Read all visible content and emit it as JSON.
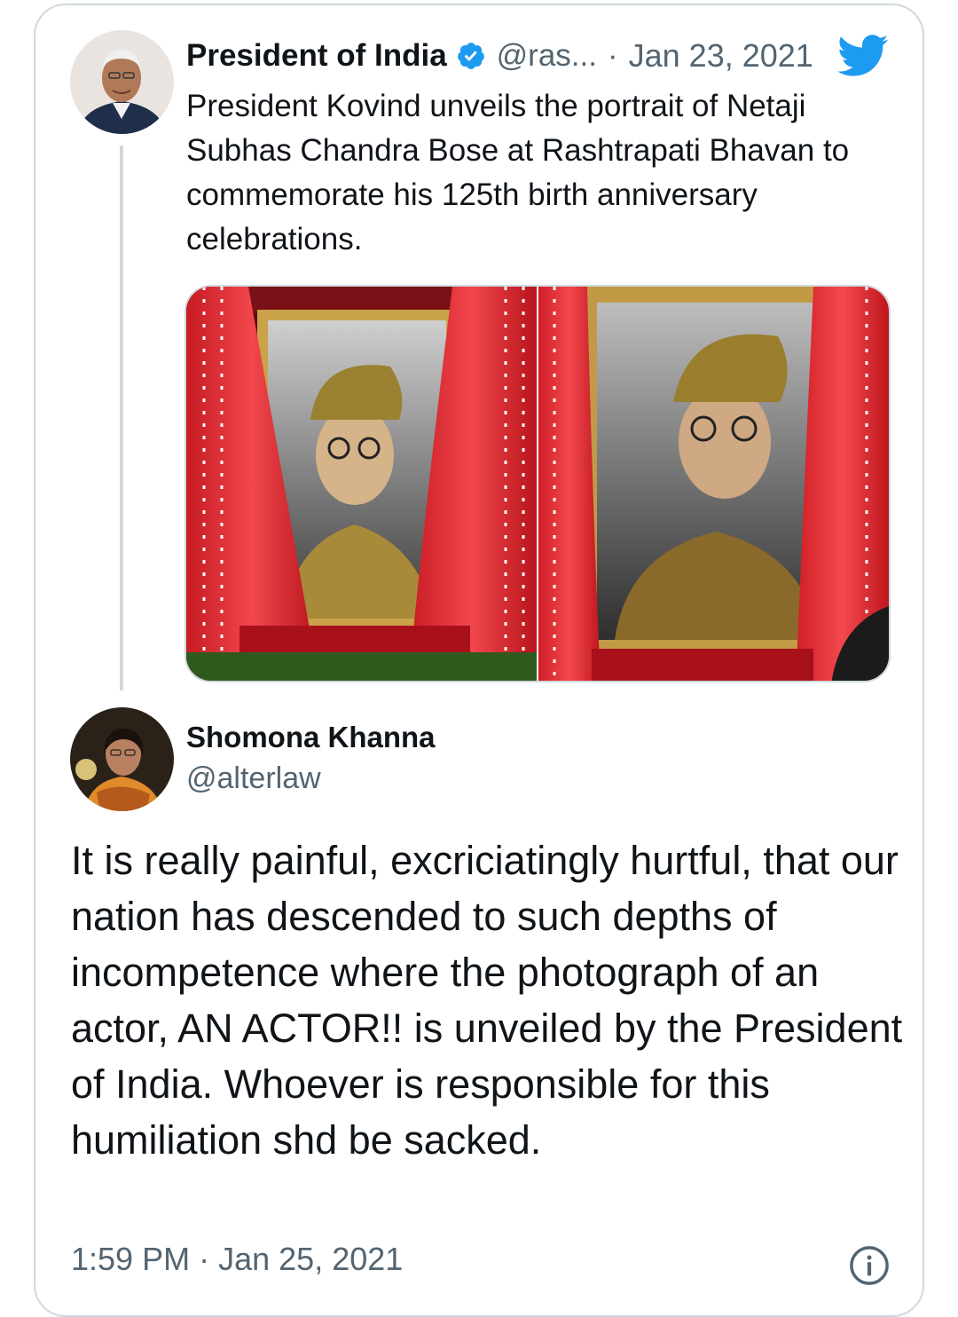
{
  "quoted_tweet": {
    "author_name": "President of India",
    "handle": "@ras...",
    "separator": "·",
    "date": "Jan 23, 2021",
    "text": "President Kovind unveils the portrait of Netaji Subhas Chandra Bose at Rashtrapati Bhavan to commemorate his 125th birth anniversary celebrations.",
    "photo_count": 2,
    "verified": true
  },
  "tweet": {
    "author_name": "Shomona Khanna",
    "handle": "@alterlaw",
    "text": "It is really painful, excriciatingly hurtful, that our nation has descended to such depths of incompetence where the photograph of an actor, AN ACTOR!! is unveiled by the President of India. Whoever is responsible for this humiliation shd be sacked.",
    "time": "1:59 PM",
    "separator": "·",
    "date": "Jan 25, 2021"
  },
  "icons": {
    "verified": "verified-badge-icon",
    "logo": "twitter-bird-icon",
    "info": "info-icon"
  },
  "colors": {
    "brand_blue": "#1d9bf0",
    "text_primary": "#0f1419",
    "text_secondary": "#536471",
    "border": "#cfd9de",
    "curtain_red": "#e0242c"
  }
}
